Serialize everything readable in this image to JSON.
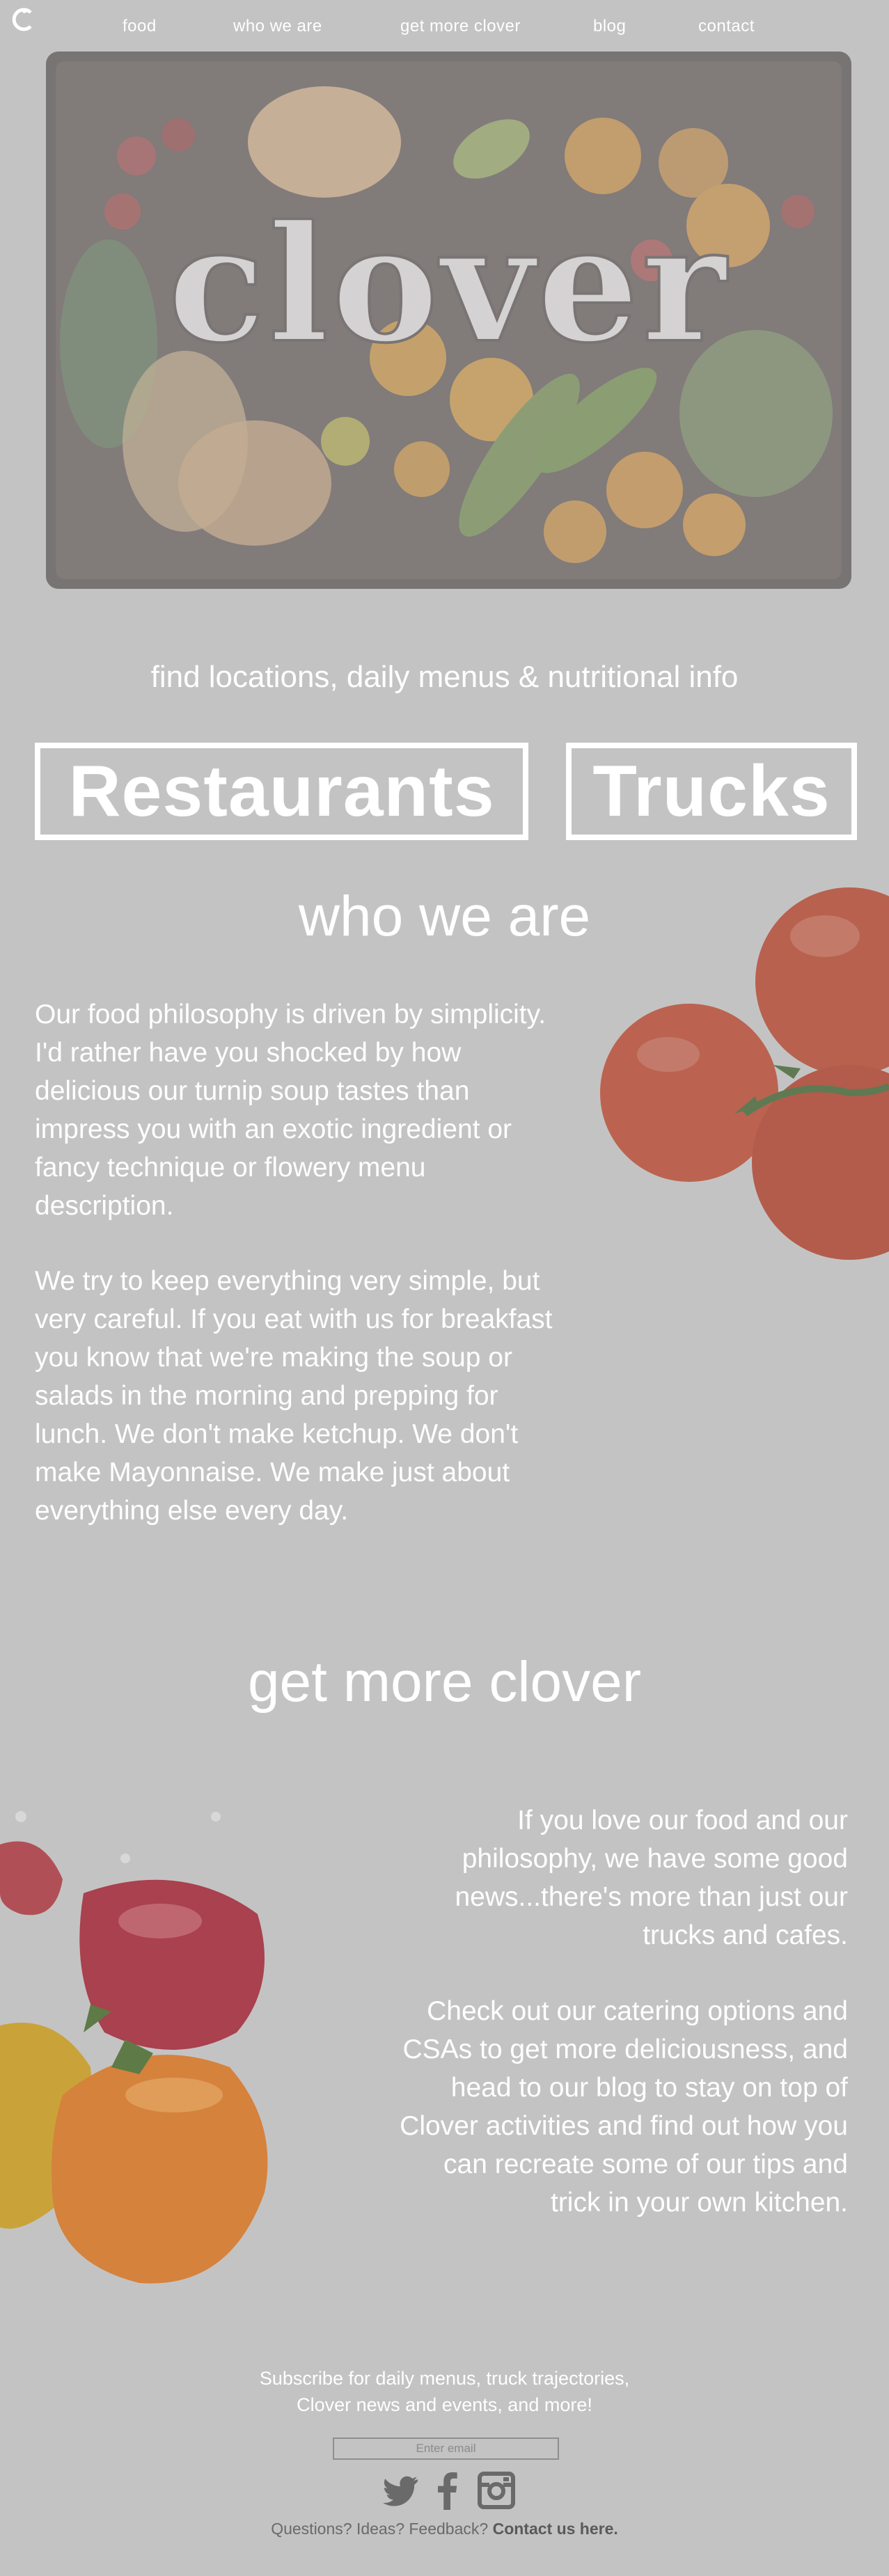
{
  "nav": {
    "logo_letter": "C",
    "items": [
      {
        "label": "food"
      },
      {
        "label": "who we are"
      },
      {
        "label": "get more clover"
      },
      {
        "label": "blog"
      },
      {
        "label": "contact"
      }
    ]
  },
  "hero": {
    "brand_text": "clover"
  },
  "tagline": "find locations, daily menus & nutritional info",
  "buttons": {
    "restaurants": "Restaurants",
    "trucks": "Trucks"
  },
  "who": {
    "title": "who we are",
    "p1": "Our food philosophy is driven by simplicity. I'd rather have you shocked by how delicious our turnip soup tastes than impress you with an exotic ingredient or fancy technique or flowery menu description.",
    "p2": "We try to keep everything very simple, but very careful. If you eat with us for breakfast you know that we're making the soup or salads in the morning and prepping for lunch. We don't make ketchup. We don't make Mayonnaise. We make just about everything else every day."
  },
  "more": {
    "title": "get more clover",
    "p1": "If you love our food and our philosophy, we have some good news...there's more than just our trucks and cafes.",
    "p2": "Check out our catering options and CSAs to get more deliciousness, and head to our blog to stay on top of Clover activities and find out how you can recreate some of our tips and trick in your  own kitchen."
  },
  "footer": {
    "subscribe_line1": "Subscribe for daily menus, truck trajectories,",
    "subscribe_line2": "Clover news and events, and more!",
    "email_placeholder": "Enter email",
    "contact_prefix": "Questions? Ideas? Feedback? ",
    "contact_link": "Contact us here.",
    "social_icons": [
      "twitter-icon",
      "facebook-icon",
      "instagram-icon"
    ]
  },
  "colors": {
    "background": "#c4c3c4",
    "text": "#ffffff",
    "footer_text": "#6a6a6a"
  }
}
